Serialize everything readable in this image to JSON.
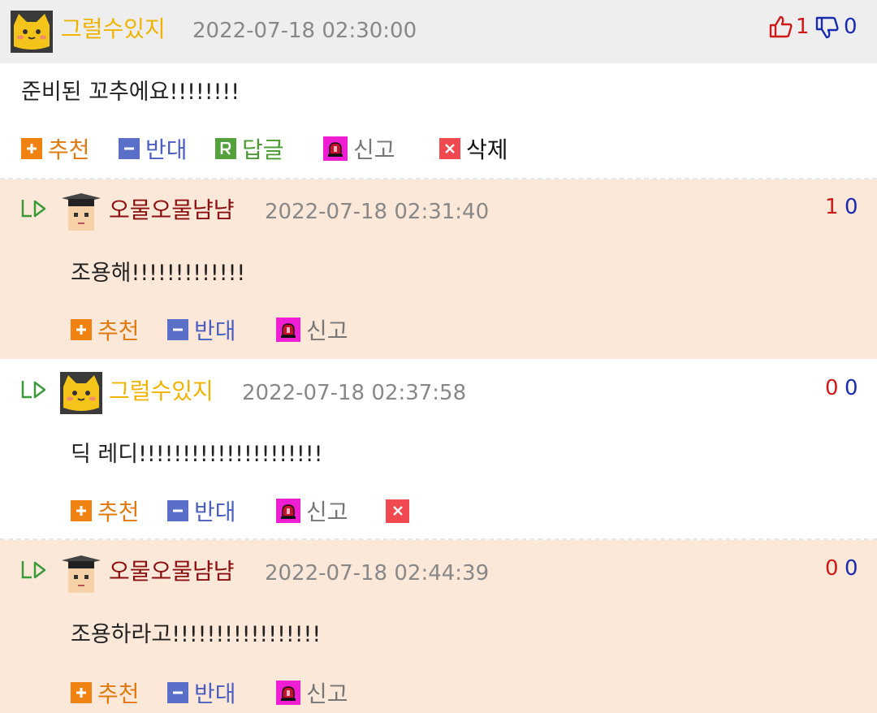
{
  "colors": {
    "header_bg": "#eeeeee",
    "highlight_bg": "#fce8d8",
    "nick_yellow": "#f0b400",
    "nick_darkred": "#8b1010",
    "up": "#d01919",
    "down": "#1a2bb0"
  },
  "post": {
    "author": "그럴수있지",
    "date": "2022-07-18 02:30:00",
    "up_count": "1",
    "down_count": "0",
    "body": "준비된 꼬추에요!!!!!!!!",
    "actions": {
      "recommend": "추천",
      "oppose": "반대",
      "reply": "답글",
      "report": "신고",
      "delete": "삭제"
    }
  },
  "comments": [
    {
      "author": "오물오물냠냠",
      "date": "2022-07-18 02:31:40",
      "up": "1",
      "down": "0",
      "body": "조용해!!!!!!!!!!!!!",
      "recommend": "추천",
      "oppose": "반대",
      "report": "신고"
    },
    {
      "author": "그럴수있지",
      "date": "2022-07-18 02:37:58",
      "up": "0",
      "down": "0",
      "body": "딕 레디!!!!!!!!!!!!!!!!!!!!!",
      "recommend": "추천",
      "oppose": "반대",
      "report": "신고"
    },
    {
      "author": "오물오물냠냠",
      "date": "2022-07-18 02:44:39",
      "up": "0",
      "down": "0",
      "body": "조용하라고!!!!!!!!!!!!!!!!!",
      "recommend": "추천",
      "oppose": "반대",
      "report": "신고"
    }
  ]
}
